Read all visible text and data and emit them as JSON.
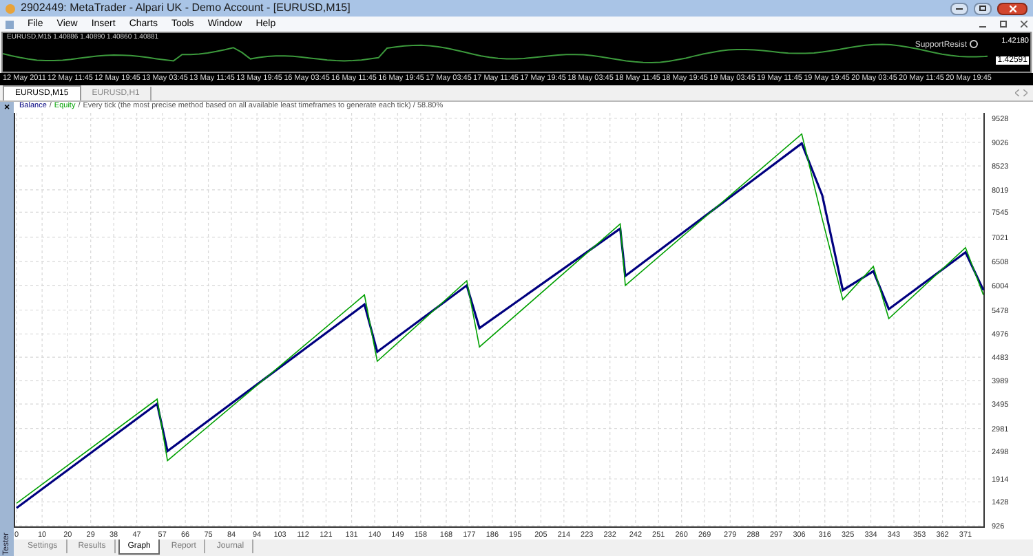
{
  "window": {
    "title": "2902449: MetaTrader - Alpari UK - Demo Account - [EURUSD,M15]"
  },
  "menu": [
    "File",
    "View",
    "Insert",
    "Charts",
    "Tools",
    "Window",
    "Help"
  ],
  "mini_chart": {
    "quote": "EURUSD,M15  1.40886 1.40890 1.40860 1.40881",
    "indicator": "SupportResist",
    "price_high": "1.42180",
    "price_current": "1.42591",
    "dates": [
      "12 May 2011",
      "12 May 11:45",
      "12 May 19:45",
      "13 May 03:45",
      "13 May 11:45",
      "13 May 19:45",
      "16 May 03:45",
      "16 May 11:45",
      "16 May 19:45",
      "17 May 03:45",
      "17 May 11:45",
      "17 May 19:45",
      "18 May 03:45",
      "18 May 11:45",
      "18 May 19:45",
      "19 May 03:45",
      "19 May 11:45",
      "19 May 19:45",
      "20 May 03:45",
      "20 May 11:45",
      "20 May 19:45"
    ]
  },
  "chart_tabs": [
    {
      "label": "EURUSD,M15",
      "selected": true
    },
    {
      "label": "EURUSD,H1",
      "selected": false
    }
  ],
  "tester": {
    "panel_label": "Tester",
    "close": "×",
    "legend_sep": "/",
    "description": "Every tick (the most precise method based on all available least timeframes to generate each tick) / 58.80%",
    "chart_data": {
      "type": "line",
      "x": [
        0,
        55,
        59,
        136,
        141,
        176,
        181,
        236,
        238,
        307,
        315,
        323,
        335,
        341,
        371,
        378
      ],
      "series": [
        {
          "name": "Balance",
          "color": "#00007f",
          "values": [
            1300,
            3500,
            2500,
            5600,
            4600,
            6000,
            5100,
            7200,
            6200,
            9000,
            7900,
            5900,
            6300,
            5500,
            6700,
            5900
          ]
        },
        {
          "name": "Equity",
          "color": "#00a000",
          "values": [
            1400,
            3600,
            2300,
            5800,
            4400,
            6100,
            4700,
            7300,
            6000,
            9200,
            7400,
            5700,
            6400,
            5300,
            6800,
            5800
          ]
        }
      ],
      "grid": true,
      "xlim": [
        0,
        378
      ],
      "ylim": [
        926,
        9528
      ],
      "xticks": [
        0,
        10,
        20,
        29,
        38,
        47,
        57,
        66,
        75,
        84,
        94,
        103,
        112,
        121,
        131,
        140,
        149,
        158,
        168,
        177,
        186,
        195,
        205,
        214,
        223,
        232,
        242,
        251,
        260,
        269,
        279,
        288,
        297,
        306,
        316,
        325,
        334,
        343,
        353,
        362,
        371
      ],
      "yticks": [
        926,
        1428,
        1914,
        2498,
        2981,
        3495,
        3989,
        4483,
        4976,
        5478,
        6004,
        6508,
        7021,
        7545,
        8019,
        8523,
        9026,
        9528
      ]
    },
    "tabs": [
      {
        "label": "Settings",
        "selected": false
      },
      {
        "label": "Results",
        "selected": false
      },
      {
        "label": "Graph",
        "selected": true
      },
      {
        "label": "Report",
        "selected": false
      },
      {
        "label": "Journal",
        "selected": false
      }
    ]
  }
}
